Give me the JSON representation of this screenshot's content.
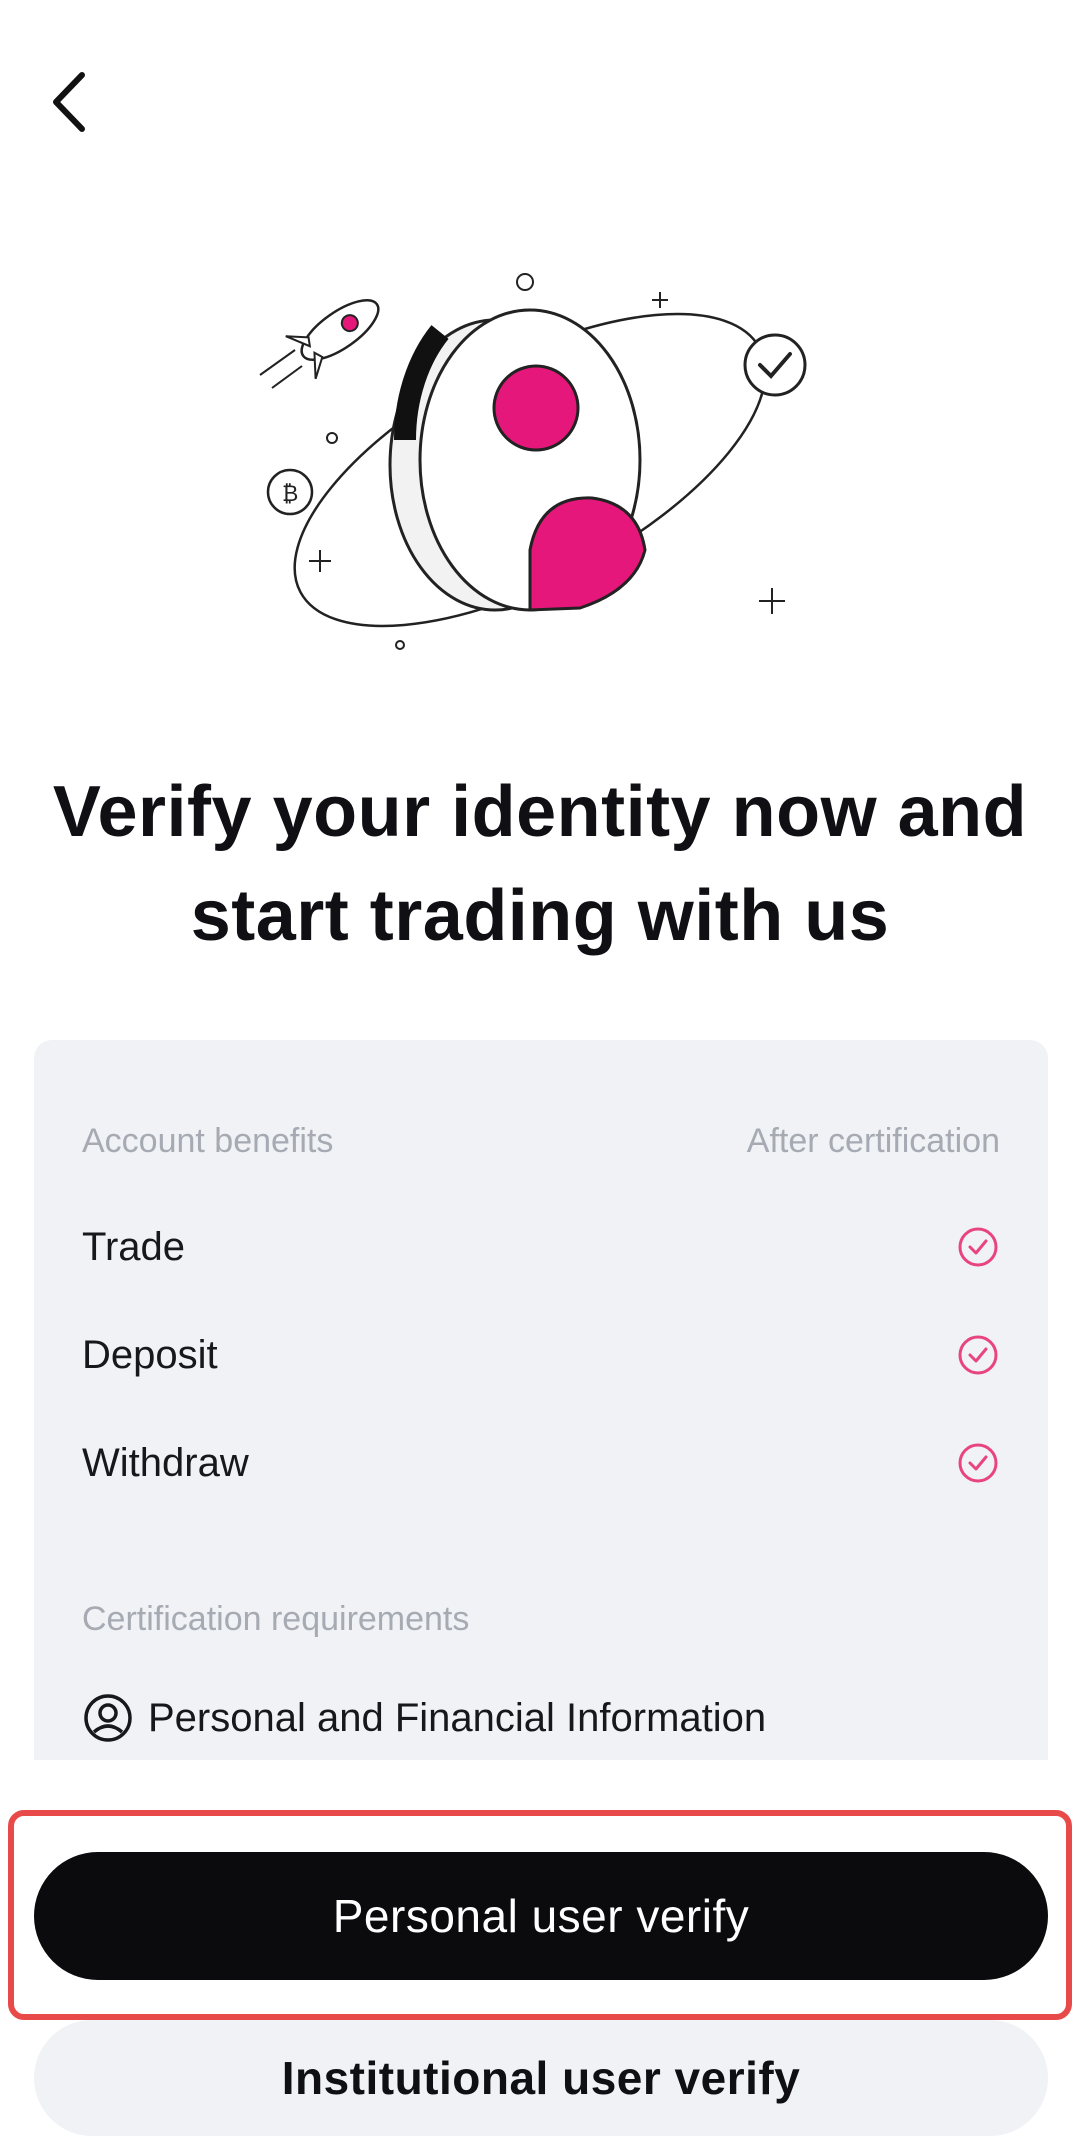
{
  "header": {
    "back_icon": "chevron-left-icon"
  },
  "hero": {
    "illustration": "identity-verification-illustration",
    "accent_color": "#e6177a"
  },
  "headline": {
    "line1": "Verify your identity now and",
    "line2": "start trading with us"
  },
  "benefits": {
    "column_left": "Account benefits",
    "column_right": "After certification",
    "items": [
      {
        "label": "Trade",
        "icon": "check-circle-icon"
      },
      {
        "label": "Deposit",
        "icon": "check-circle-icon"
      },
      {
        "label": "Withdraw",
        "icon": "check-circle-icon"
      }
    ],
    "check_color": "#e8457f"
  },
  "requirements": {
    "title": "Certification requirements",
    "items": [
      {
        "label": "Personal and Financial Information",
        "icon": "user-circle-icon"
      }
    ]
  },
  "actions": {
    "primary_label": "Personal user verify",
    "secondary_label": "Institutional user verify",
    "highlight_color": "#e84a4a"
  }
}
